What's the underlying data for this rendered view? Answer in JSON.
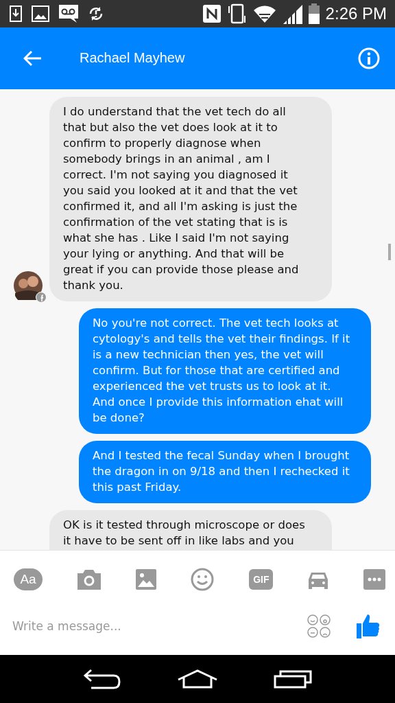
{
  "status_bar": {
    "time": "2:26 PM"
  },
  "header": {
    "title": "Rachael Mayhew"
  },
  "messages": [
    {
      "kind": "received",
      "avatar": true,
      "cut": false,
      "text": "I do understand that the vet tech do all that but also the vet does look at it to confirm to properly diagnose when somebody brings in an animal , am I correct. I'm not saying you diagnosed it you said you looked at it and that the vet confirmed it, and all I'm asking is just the confirmation of the vet stating that is is what she has . Like I said I'm not saying your lying or anything. And that will be great if you can provide those please and thank you."
    },
    {
      "kind": "sent",
      "cut": false,
      "text": "No you're not correct. The vet tech looks at cytology's and tells the vet their findings. If it is a new technician then yes, the vet will confirm. But for those that are certified and experienced the vet trusts us to look at it. And once I provide this information ehat will be done?"
    },
    {
      "kind": "sent",
      "cut": false,
      "text": "And I tested the fecal Sunday when I brought the dragon in on 9/18 and then I rechecked it this past Friday."
    },
    {
      "kind": "received",
      "cut": true,
      "text": "OK is it tested through microscope or does it have to be sent off in like labs and you"
    }
  ],
  "toolbar": [
    {
      "kind": "text",
      "label": "Aa"
    },
    {
      "kind": "camera"
    },
    {
      "kind": "image"
    },
    {
      "kind": "emoji"
    },
    {
      "kind": "gif",
      "label": "GIF"
    },
    {
      "kind": "car"
    },
    {
      "kind": "more"
    }
  ],
  "composer": {
    "placeholder": "Write a message..."
  }
}
